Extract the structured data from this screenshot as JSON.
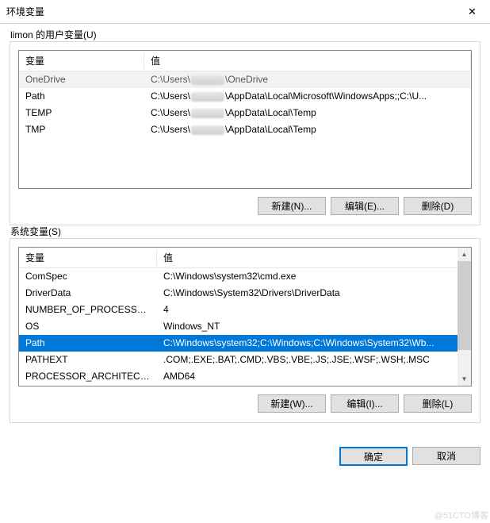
{
  "window": {
    "title": "环境变量",
    "close_glyph": "✕"
  },
  "user_section": {
    "legend": "limon 的用户变量(U)",
    "col_var": "变量",
    "col_val": "值",
    "rows": [
      {
        "name": "OneDrive",
        "pre": "C:\\Users\\",
        "post": "\\OneDrive"
      },
      {
        "name": "Path",
        "pre": "C:\\Users\\",
        "post": "\\AppData\\Local\\Microsoft\\WindowsApps;;C:\\U..."
      },
      {
        "name": "TEMP",
        "pre": "C:\\Users\\",
        "post": "\\AppData\\Local\\Temp"
      },
      {
        "name": "TMP",
        "pre": "C:\\Users\\",
        "post": "\\AppData\\Local\\Temp"
      }
    ],
    "buttons": {
      "new": "新建(N)...",
      "edit": "编辑(E)...",
      "delete": "删除(D)"
    }
  },
  "system_section": {
    "legend": "系统变量(S)",
    "col_var": "变量",
    "col_val": "值",
    "rows": [
      {
        "name": "ComSpec",
        "value": "C:\\Windows\\system32\\cmd.exe"
      },
      {
        "name": "DriverData",
        "value": "C:\\Windows\\System32\\Drivers\\DriverData"
      },
      {
        "name": "NUMBER_OF_PROCESSORS",
        "value": "4"
      },
      {
        "name": "OS",
        "value": "Windows_NT"
      },
      {
        "name": "Path",
        "value": "C:\\Windows\\system32;C:\\Windows;C:\\Windows\\System32\\Wb...",
        "selected": true
      },
      {
        "name": "PATHEXT",
        "value": ".COM;.EXE;.BAT;.CMD;.VBS;.VBE;.JS;.JSE;.WSF;.WSH;.MSC"
      },
      {
        "name": "PROCESSOR_ARCHITECT...",
        "value": "AMD64"
      }
    ],
    "buttons": {
      "new": "新建(W)...",
      "edit": "编辑(I)...",
      "delete": "删除(L)"
    }
  },
  "footer": {
    "ok": "确定",
    "cancel": "取消"
  },
  "watermark": "@51CTO博客"
}
